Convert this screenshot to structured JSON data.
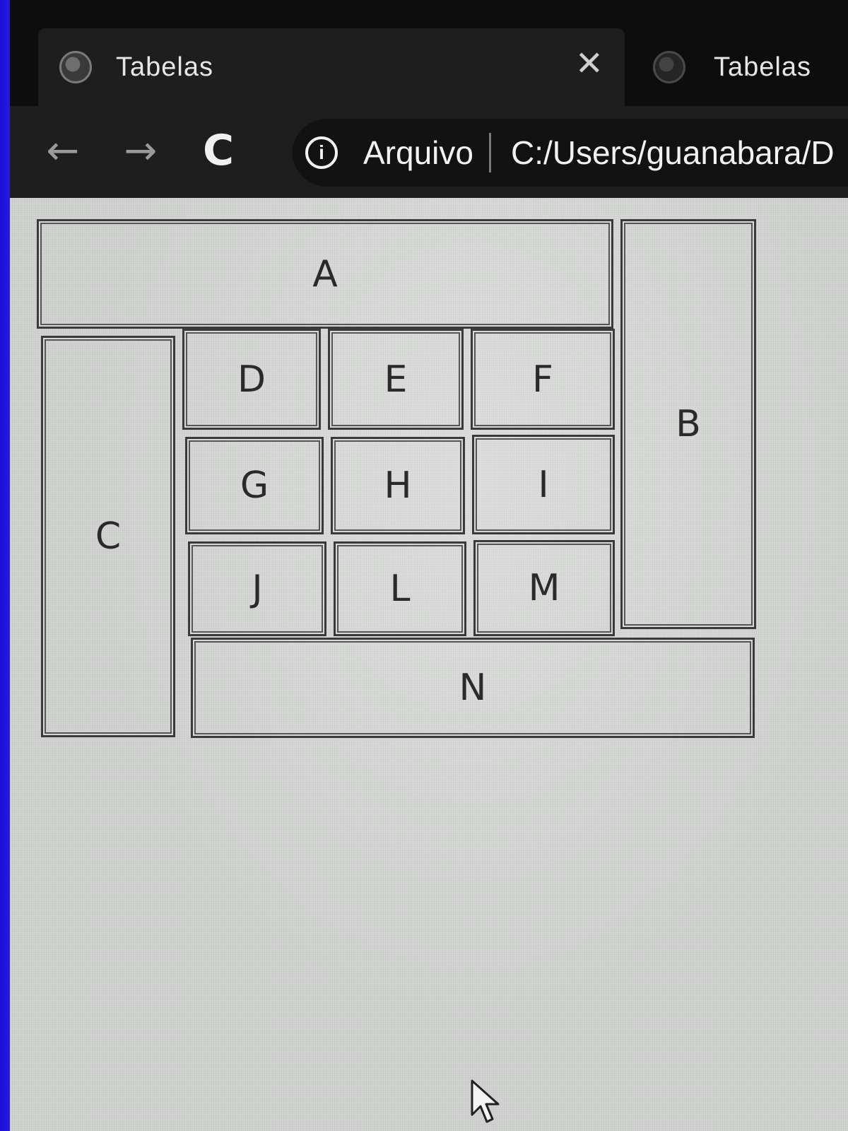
{
  "tabs": [
    {
      "title": "Tabelas",
      "active": true,
      "close_symbol": "✕"
    },
    {
      "title": "Tabelas",
      "active": false
    }
  ],
  "toolbar": {
    "back_symbol": "←",
    "forward_symbol": "→",
    "reload_symbol": "C",
    "info_symbol": "i",
    "address_label": "Arquivo",
    "address_url": "C:/Users/guanabara/D"
  },
  "table": {
    "cells": {
      "a": "A",
      "b": "B",
      "c": "C",
      "d": "D",
      "e": "E",
      "f": "F",
      "g": "G",
      "h": "H",
      "i": "I",
      "j": "J",
      "l": "L",
      "m": "M",
      "n": "N"
    }
  },
  "colors": {
    "monitor_bezel": "#1a10c8",
    "browser_chrome": "#1e1e1e",
    "page_background": "#d2d4d2",
    "cell_border": "#3a3a3a"
  }
}
